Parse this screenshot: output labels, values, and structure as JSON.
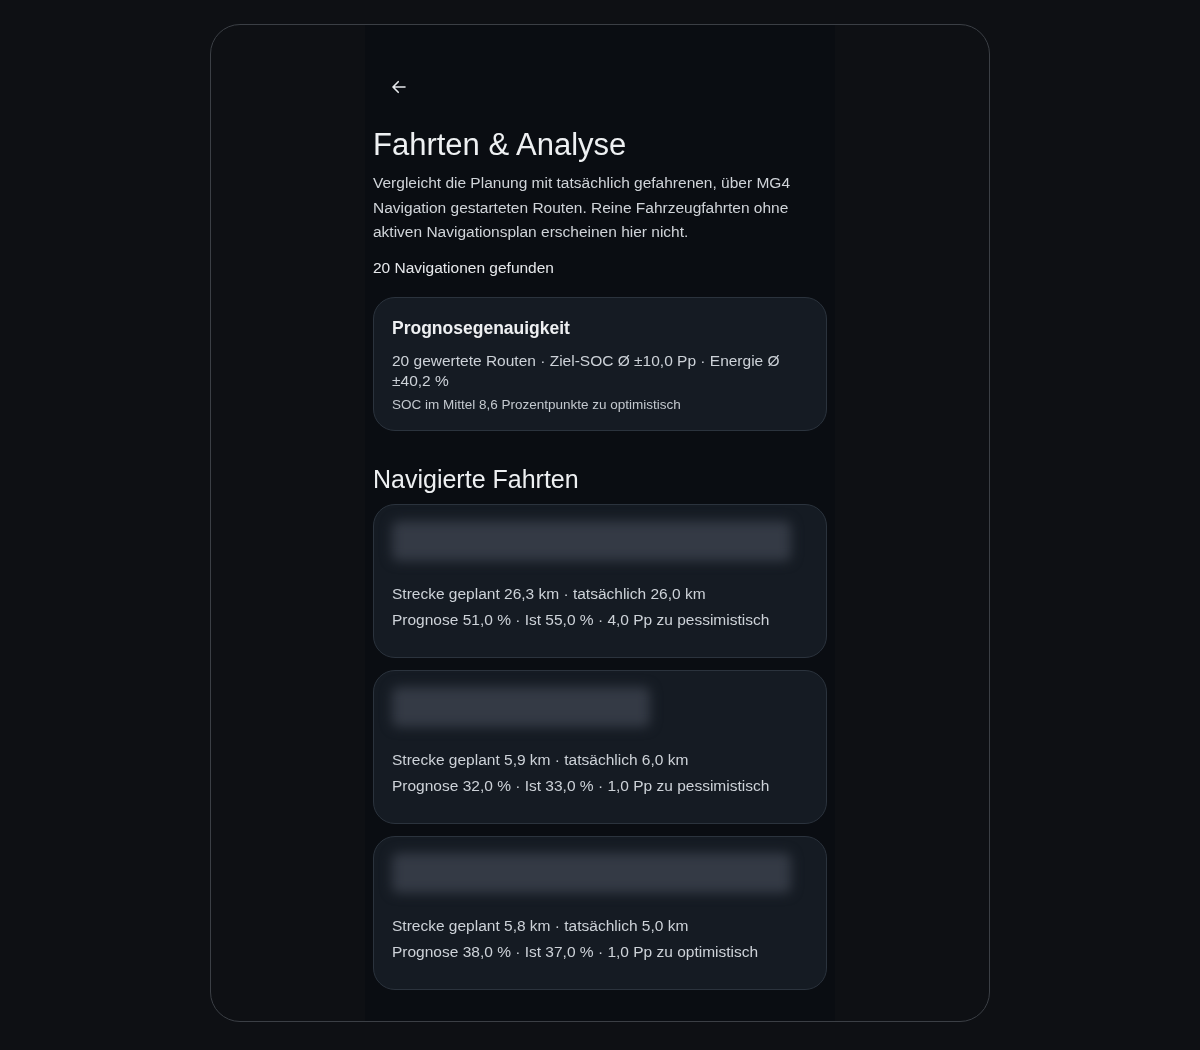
{
  "title": "Fahrten & Analyse",
  "description": "Vergleicht die Planung mit tatsächlich gefahrenen, über MG4 Navigation gestarteten Routen. Reine Fahrzeugfahrten ohne aktiven Navigationsplan erscheinen hier nicht.",
  "count": "20 Navigationen gefunden",
  "summary": {
    "title": "Prognosegenauigkeit",
    "stats": "20 gewertete Routen · Ziel-SOC Ø ±10,0 Pp · Energie Ø ±40,2 %",
    "note": "SOC im Mittel 8,6 Prozentpunkte zu optimistisch"
  },
  "section_title": "Navigierte Fahrten",
  "trips": [
    {
      "distance": "Strecke geplant 26,3 km · tatsächlich 26,0 km",
      "forecast": "Prognose 51,0 % · Ist 55,0 % · 4,0 Pp zu pessimistisch"
    },
    {
      "distance": "Strecke geplant 5,9 km · tatsächlich 6,0 km",
      "forecast": "Prognose 32,0 % · Ist 33,0 % · 1,0 Pp zu pessimistisch"
    },
    {
      "distance": "Strecke geplant 5,8 km · tatsächlich 5,0 km",
      "forecast": "Prognose 38,0 % · Ist 37,0 % · 1,0 Pp zu optimistisch"
    }
  ]
}
